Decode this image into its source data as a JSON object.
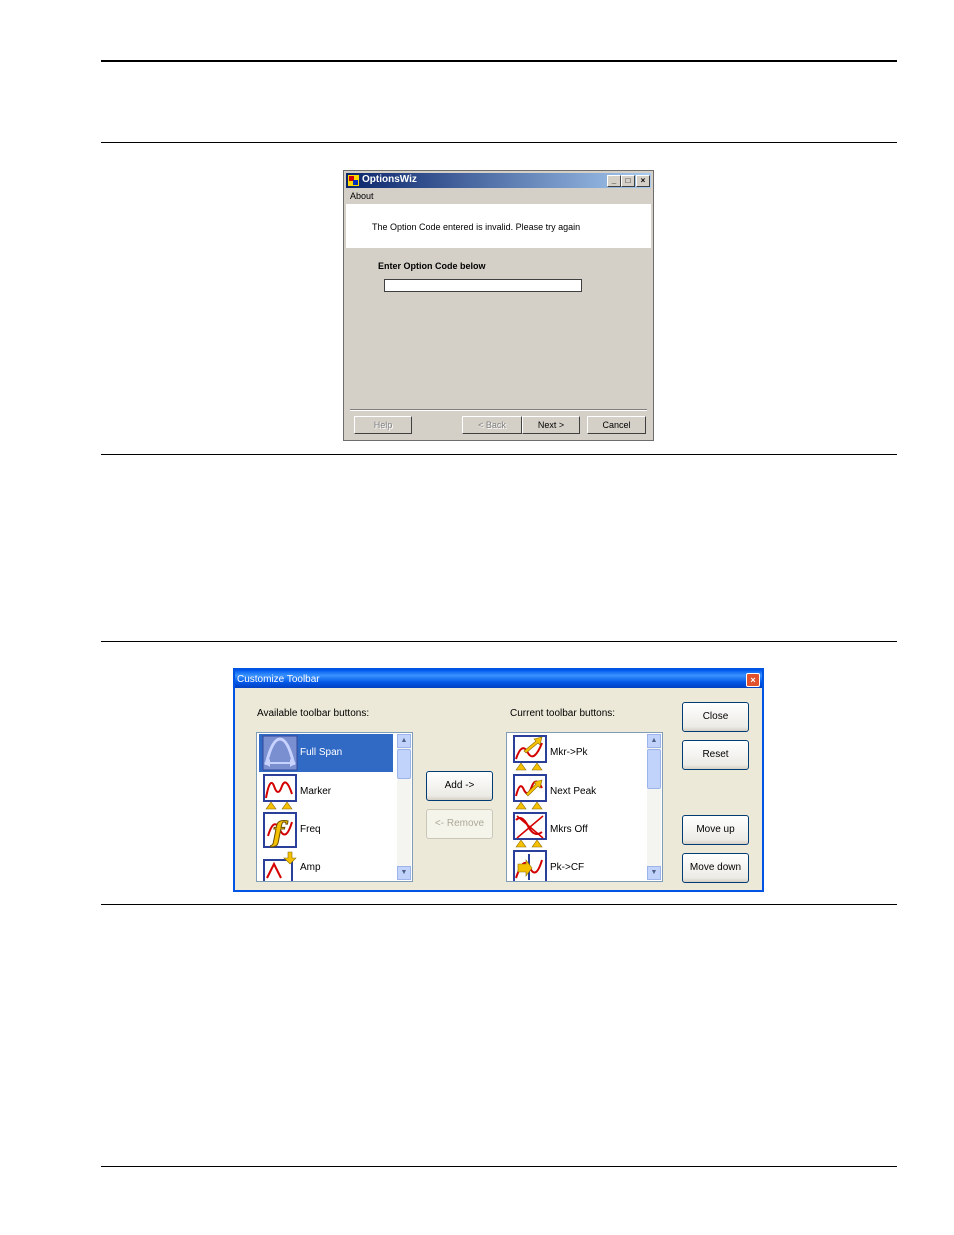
{
  "options_wiz": {
    "title": "OptionsWiz",
    "caption_buttons": [
      "_",
      "□",
      "×"
    ],
    "menu": [
      "About"
    ],
    "message": "The Option Code entered is invalid. Please try again",
    "prompt": "Enter Option Code below",
    "option_code_value": "",
    "buttons": {
      "help": "Help",
      "back": "< Back",
      "next": "Next >",
      "cancel": "Cancel"
    }
  },
  "customize_toolbar": {
    "title": "Customize Toolbar",
    "close_glyph": "×",
    "available_label": "Available toolbar buttons:",
    "current_label": "Current toolbar buttons:",
    "available_items": [
      {
        "label": "Full Span",
        "icon": "full-span-icon",
        "selected": true
      },
      {
        "label": "Marker",
        "icon": "marker-icon",
        "selected": false
      },
      {
        "label": "Freq",
        "icon": "freq-icon",
        "selected": false
      },
      {
        "label": "Amp",
        "icon": "amp-icon",
        "selected": false
      }
    ],
    "current_items": [
      {
        "label": "Mkr->Pk",
        "icon": "mkr-to-pk-icon",
        "selected": false
      },
      {
        "label": "Next Peak",
        "icon": "next-peak-icon",
        "selected": false
      },
      {
        "label": "Mkrs Off",
        "icon": "mkrs-off-icon",
        "selected": false
      },
      {
        "label": "Pk->CF",
        "icon": "pk-to-cf-icon",
        "selected": false
      }
    ],
    "buttons": {
      "add": "Add ->",
      "remove": "<- Remove",
      "close": "Close",
      "reset": "Reset",
      "move_up": "Move up",
      "move_down": "Move down"
    },
    "scroll_arrows": {
      "up": "▲",
      "down": "▼"
    }
  },
  "colors": {
    "selection": "#316ac5",
    "xp_title": "#0054e3",
    "classic_title": "#0a246a",
    "trace_red": "#d40000",
    "marker_yellow": "#f5c000"
  }
}
